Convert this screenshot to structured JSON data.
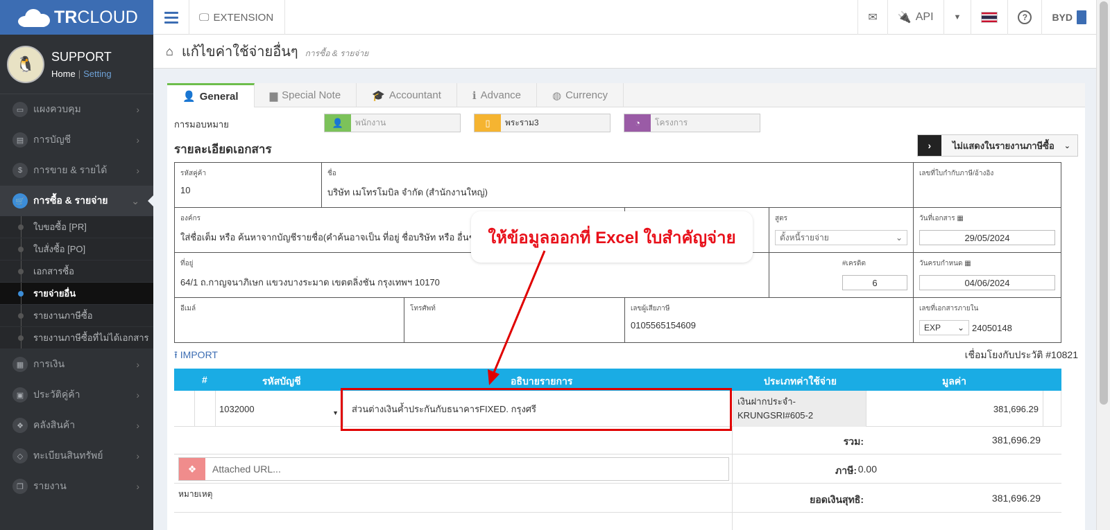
{
  "brand": {
    "strong": "TR",
    "light": "CLOUD"
  },
  "topbar": {
    "extension_label": "EXTENSION",
    "api_label": "API",
    "company_code": "BYD"
  },
  "profile": {
    "name": "SUPPORT",
    "home": "Home",
    "separator": "|",
    "setting": "Setting"
  },
  "sidebar": {
    "items_top": [
      {
        "label": "แผงควบคุม"
      },
      {
        "label": "การบัญชี"
      },
      {
        "label": "การขาย & รายได้"
      }
    ],
    "active_item": {
      "label": "การซื้อ & รายจ่าย"
    },
    "sub_items": [
      {
        "label": "ใบขอซื้อ [PR]"
      },
      {
        "label": "ใบสั่งซื้อ [PO]"
      },
      {
        "label": "เอกสารซื้อ"
      },
      {
        "label": "รายจ่ายอื่น"
      },
      {
        "label": "รายงานภาษีซื้อ"
      },
      {
        "label": "รายงานภาษีซื้อที่ไม่ได้เอกสาร"
      }
    ],
    "items_bottom": [
      {
        "label": "การเงิน"
      },
      {
        "label": "ประวัติคู่ค้า"
      },
      {
        "label": "คลังสินค้า"
      },
      {
        "label": "ทะเบียนสินทรัพย์"
      },
      {
        "label": "รายงาน"
      }
    ]
  },
  "page": {
    "title": "แก้ไขค่าใช้จ่ายอื่นๆ",
    "subtitle": "การซื้อ & รายจ่าย"
  },
  "tabs": [
    "General",
    "Special Note",
    "Accountant",
    "Advance",
    "Currency"
  ],
  "assign": {
    "label": "การมอบหมาย",
    "employee_placeholder": "พนักงาน",
    "branch_value": "พระราม3",
    "project_placeholder": "โครงการ"
  },
  "section_title": "รายละเอียดเอกสาร",
  "vat_option": "ไม่แสดงในรายงานภาษีซื้อ",
  "details": {
    "partner_code_label": "รหัสคู่ค้า",
    "partner_code": "10",
    "name_label": "ชื่อ",
    "name": "บริษัท เมโทรโมบิล จำกัด (สำนักงานใหญ่)",
    "tax_invoice_ref_label": "เลขที่ใบกำกับภาษี/อ้างอิง",
    "org_label": "องค์กร",
    "org_hint": "ใส่ชื่อเต็ม หรือ ค้นหาจากบัญชีรายชื่อ(คำค้นอาจเป็น ที่อยู่ ชื่อบริษัท หรือ อื่นๆ)",
    "formula_label": "สูตร",
    "formula_value": "ตั้งหนี้รายจ่าย",
    "doc_date_label": "วันที่เอกสาร",
    "doc_date": "29/05/2024",
    "address_label": "ที่อยู่",
    "address": "64/1 ถ.กาญจนาภิเษก แขวงบางระมาด เขตตลิ่งชัน  กรุงเทพฯ 10170",
    "credit_label": "#เครดิต",
    "credit": "6",
    "due_date_label": "วันครบกำหนด",
    "due_date": "04/06/2024",
    "email_label": "อีเมล์",
    "phone_label": "โทรศัพท์",
    "tax_id_label": "เลขผู้เสียภาษี",
    "tax_id": "0105565154609",
    "internal_doc_label": "เลขที่เอกสารภายใน",
    "internal_prefix": "EXP",
    "internal_number": "24050148"
  },
  "import_label": "IMPORT",
  "history_link": "เชื่อมโยงกับประวัติ #10821",
  "grid": {
    "headers": {
      "num": "#",
      "account": "รหัสบัญชี",
      "description": "อธิบายรายการ",
      "expense_type": "ประเภทค่าใช้จ่าย",
      "amount": "มูลค่า"
    },
    "rows": [
      {
        "account": "1032000",
        "description": "ส่วนต่างเงินค้ำประกันกับธนาคารFIXED. กรุงศรี",
        "expense_type_line1": "เงินฝากประจำ-",
        "expense_type_line2": "KRUNGSRI#605-2",
        "amount": "381,696.29"
      }
    ]
  },
  "summary": {
    "total_label": "รวม:",
    "total": "381,696.29",
    "tax_label": "ภาษี:",
    "tax": "0.00",
    "net_label": "ยอดเงินสุทธิ:",
    "net": "381,696.29"
  },
  "attach_placeholder": "Attached URL...",
  "remark_label": "หมายเหตุ",
  "callout_text": "ให้ข้อมูลออกที่ Excel ใบสำคัญจ่าย",
  "colors": {
    "brand": "#3c6db3",
    "grid_header": "#1aace4",
    "highlight": "#e00000",
    "tab_active": "#6dbd4b"
  }
}
